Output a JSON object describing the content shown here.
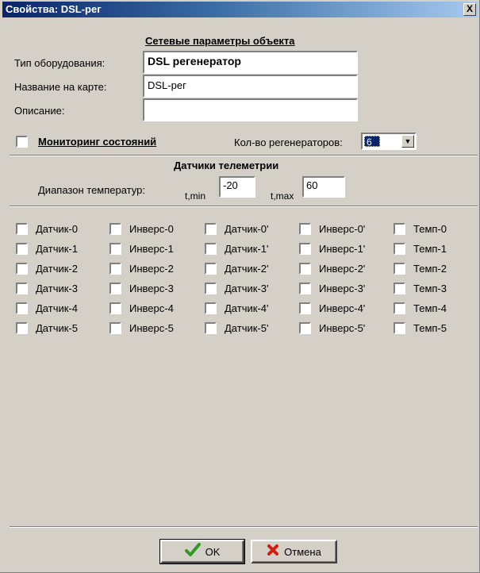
{
  "window": {
    "title": "Свойства: DSL-рег",
    "close_label": "X"
  },
  "network": {
    "heading": "Сетевые параметры объекта",
    "equipment_type_label": "Тип оборудования:",
    "equipment_type_value": "DSL регенератор",
    "map_name_label": "Название на карте:",
    "map_name_value": "DSL-рег",
    "description_label": "Описание:",
    "description_value": ""
  },
  "monitoring": {
    "label": "Мониторинг состояний",
    "regenerators_label": "Кол-во регенераторов:",
    "regenerators_value": "6"
  },
  "telemetry": {
    "heading": "Датчики телеметрии",
    "range_label": "Диапазон температур:",
    "tmin_label": "t,min",
    "tmin_value": "-20",
    "tmax_label": "t,max",
    "tmax_value": "60"
  },
  "sensors": {
    "columns": [
      [
        "Датчик-0",
        "Датчик-1",
        "Датчик-2",
        "Датчик-3",
        "Датчик-4",
        "Датчик-5"
      ],
      [
        "Инверс-0",
        "Инверс-1",
        "Инверс-2",
        "Инверс-3",
        "Инверс-4",
        "Инверс-5"
      ],
      [
        "Датчик-0'",
        "Датчик-1'",
        "Датчик-2'",
        "Датчик-3'",
        "Датчик-4'",
        "Датчик-5'"
      ],
      [
        "Инверс-0'",
        "Инверс-1'",
        "Инверс-2'",
        "Инверс-3'",
        "Инверс-4'",
        "Инверс-5'"
      ],
      [
        "Темп-0",
        "Темп-1",
        "Темп-2",
        "Темп-3",
        "Темп-4",
        "Темп-5"
      ]
    ]
  },
  "buttons": {
    "ok_label": "OK",
    "cancel_label": "Отмена"
  },
  "colors": {
    "ok_icon": "#2e9a1e",
    "cancel_icon": "#d21c0c",
    "titlebar": "#0a246a"
  }
}
